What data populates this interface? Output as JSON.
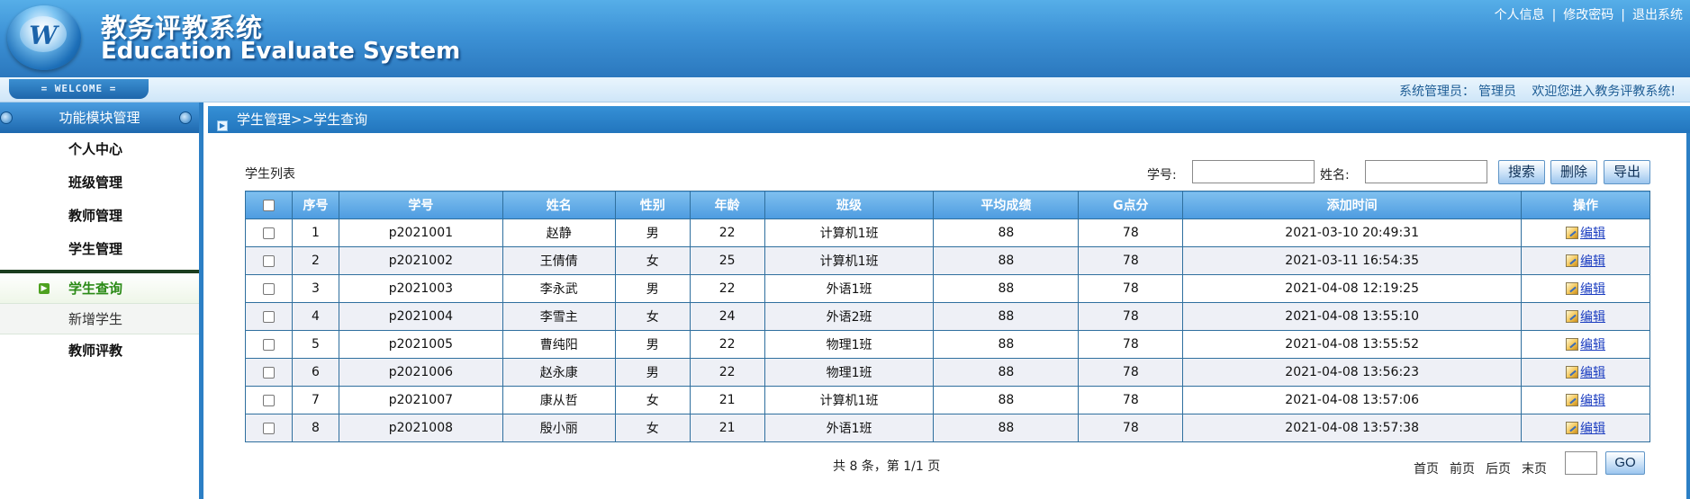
{
  "header": {
    "logo_letter": "W",
    "title_cn": "教务评教系统",
    "title_en": "Education Evaluate System",
    "links": [
      "个人信息",
      "修改密码",
      "退出系统"
    ],
    "separator": "|"
  },
  "welcome_bar": {
    "pill": "= WELCOME =",
    "role_label": "系统管理员：",
    "user": "管理员",
    "greeting": "欢迎您进入教务评教系统!"
  },
  "sidebar": {
    "title": "功能模块管理",
    "items_top": [
      "个人中心",
      "班级管理",
      "教师管理",
      "学生管理"
    ],
    "sub_items": [
      "学生查询",
      "新增学生"
    ],
    "items_bottom": [
      "教师评教"
    ]
  },
  "content": {
    "breadcrumb": "学生管理>>学生查询",
    "list_title": "学生列表",
    "search": {
      "id_label": "学号:",
      "name_label": "姓名:",
      "id_value": "",
      "name_value": ""
    },
    "buttons": {
      "search": "搜索",
      "delete": "删除",
      "export": "导出"
    },
    "table": {
      "headers": [
        "序号",
        "学号",
        "姓名",
        "性别",
        "年龄",
        "班级",
        "平均成绩",
        "G点分",
        "添加时间",
        "操作"
      ],
      "edit_label": "编辑",
      "rows": [
        [
          "1",
          "p2021001",
          "赵静",
          "男",
          "22",
          "计算机1班",
          "88",
          "78",
          "2021-03-10 20:49:31"
        ],
        [
          "2",
          "p2021002",
          "王倩倩",
          "女",
          "25",
          "计算机1班",
          "88",
          "78",
          "2021-03-11 16:54:35"
        ],
        [
          "3",
          "p2021003",
          "李永武",
          "男",
          "22",
          "外语1班",
          "88",
          "78",
          "2021-04-08 12:19:25"
        ],
        [
          "4",
          "p2021004",
          "李雪主",
          "女",
          "24",
          "外语2班",
          "88",
          "78",
          "2021-04-08 13:55:10"
        ],
        [
          "5",
          "p2021005",
          "曹纯阳",
          "男",
          "22",
          "物理1班",
          "88",
          "78",
          "2021-04-08 13:55:52"
        ],
        [
          "6",
          "p2021006",
          "赵永康",
          "男",
          "22",
          "物理1班",
          "88",
          "78",
          "2021-04-08 13:56:23"
        ],
        [
          "7",
          "p2021007",
          "康从哲",
          "女",
          "21",
          "计算机1班",
          "88",
          "78",
          "2021-04-08 13:57:06"
        ],
        [
          "8",
          "p2021008",
          "殷小丽",
          "女",
          "21",
          "外语1班",
          "88",
          "78",
          "2021-04-08 13:57:38"
        ]
      ]
    },
    "pager": {
      "info": "共 8 条，第 1/1 页",
      "first": "首页",
      "prev": "前页",
      "next": "后页",
      "last": "末页",
      "page_value": "",
      "go": "GO"
    }
  },
  "colors": {
    "header_blue": "#3d92d6",
    "sidebar_border": "#2c7fc5",
    "active_green": "#2a8a16",
    "table_header": "#4d9be0",
    "link": "#1a3cc0"
  }
}
